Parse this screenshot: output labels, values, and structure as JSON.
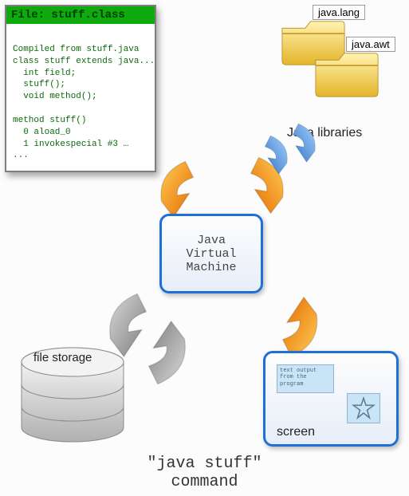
{
  "classfile": {
    "title": "File: stuff.class",
    "body": "\nCompiled from stuff.java\nclass stuff extends java...\n  int field;\n  stuff();\n  void method();\n\nmethod stuff()\n  0 aload_0\n  1 invokespecial #3 …\n..."
  },
  "libraries": {
    "folders": [
      {
        "label": "java.lang"
      },
      {
        "label": "java.awt"
      }
    ],
    "caption": "Java libraries"
  },
  "jvm": {
    "label": "Java\nVirtual\nMachine"
  },
  "screen": {
    "text_output": "text output\nfrom the\nprogram",
    "label": "screen"
  },
  "storage": {
    "label": "file storage"
  },
  "caption": "\"java stuff\"\ncommand",
  "icons": {
    "folder": "folder-icon",
    "cylinder": "database-cylinder-icon",
    "star": "star-icon"
  },
  "colors": {
    "arrow_orange_a": "#f6a21b",
    "arrow_orange_b": "#e56a00",
    "arrow_blue_a": "#69a8ef",
    "arrow_blue_b": "#2f74c6",
    "arrow_gray_a": "#bcbcbc",
    "arrow_gray_b": "#7d7d7d",
    "jvm_border": "#1e6fd6"
  }
}
